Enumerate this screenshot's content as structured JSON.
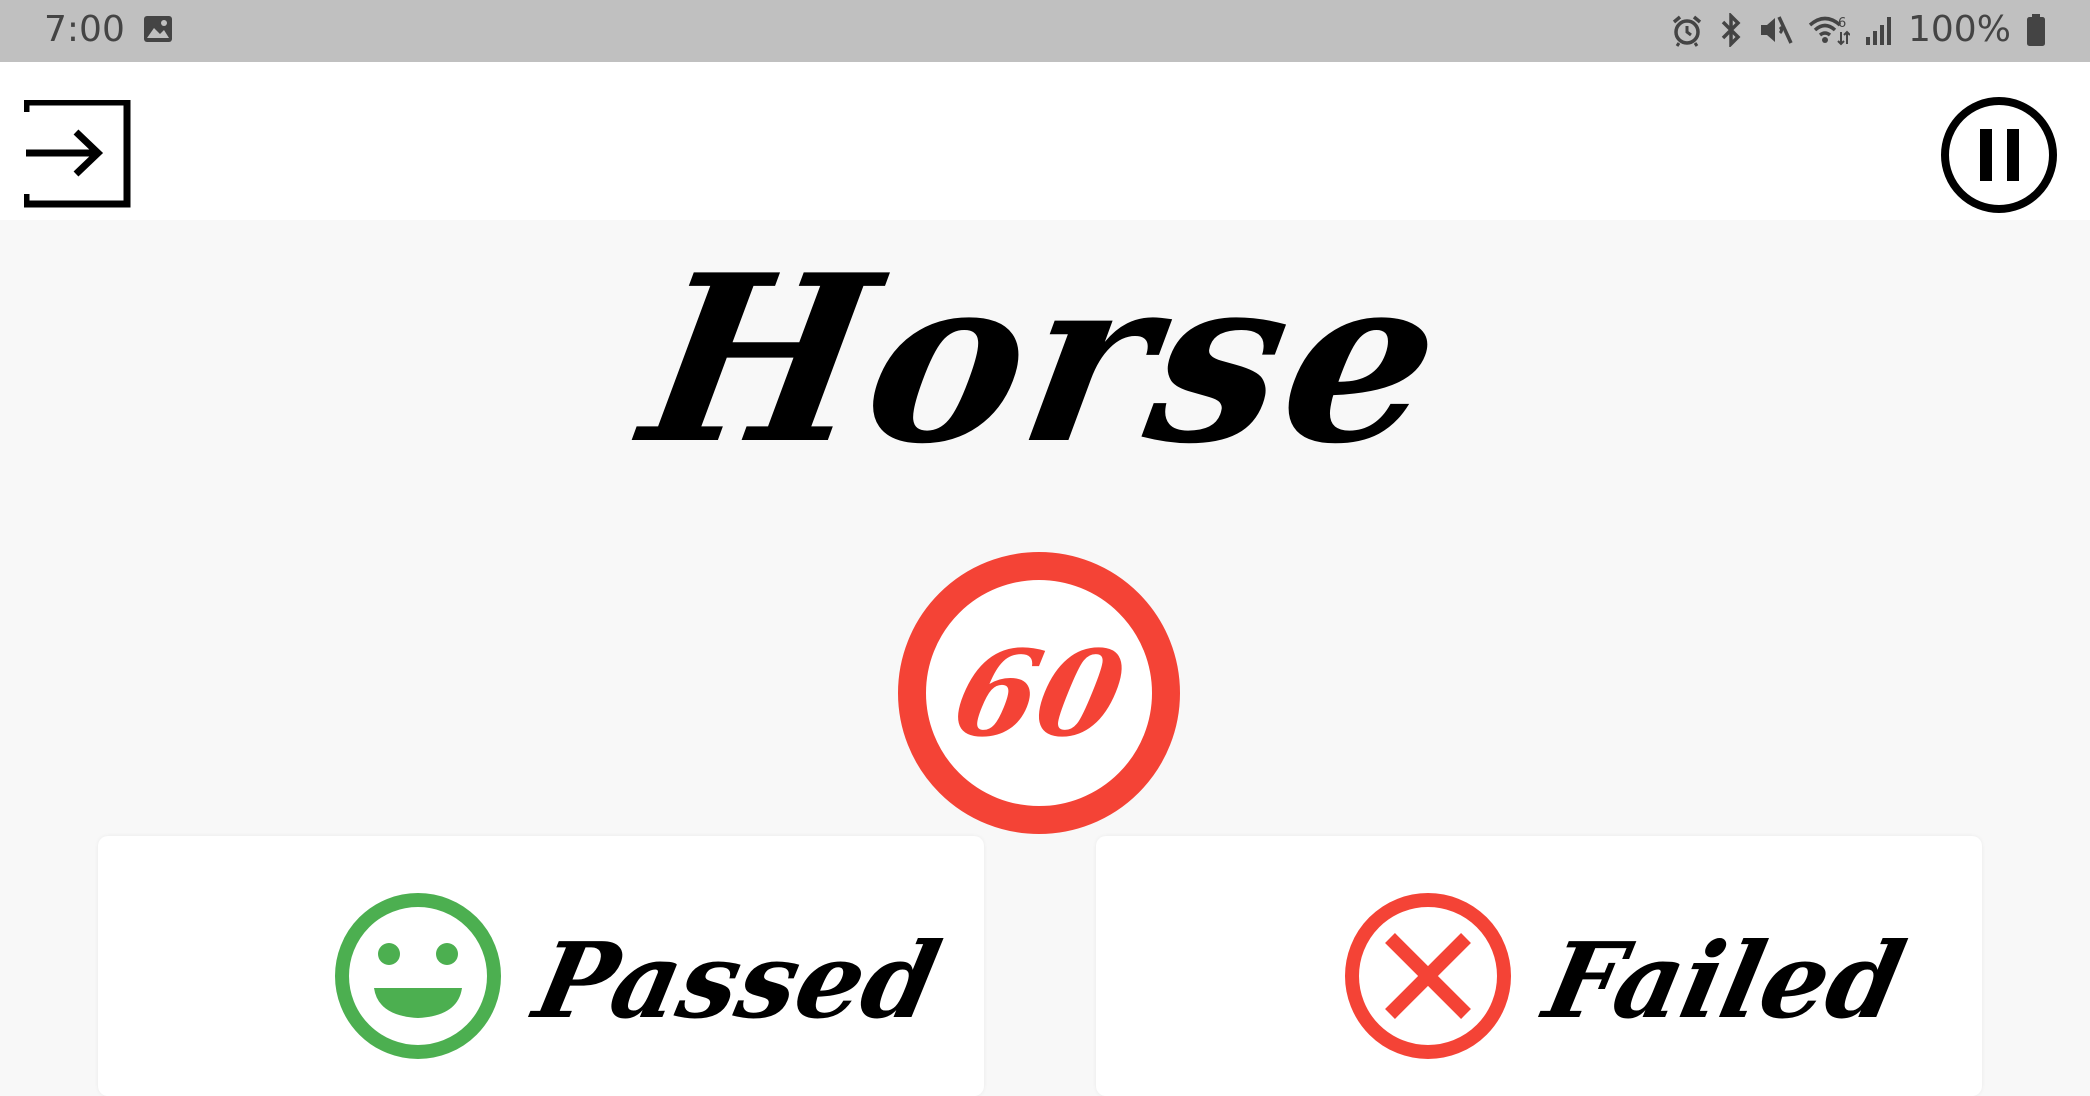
{
  "status_bar": {
    "time": "7:00",
    "battery": "100%",
    "icons": [
      "image-icon",
      "alarm-icon",
      "bluetooth-icon",
      "mute-icon",
      "wifi-icon",
      "signal-icon",
      "battery-icon"
    ]
  },
  "toolbar": {
    "exit_icon": "exit-icon",
    "pause_icon": "pause-icon"
  },
  "game": {
    "word": "Horse",
    "timer": "60",
    "timer_color": "#f44336"
  },
  "actions": {
    "passed": {
      "label": "Passed",
      "icon": "smiley-icon",
      "color": "#4caf50"
    },
    "failed": {
      "label": "Failed",
      "icon": "x-circle-icon",
      "color": "#f44336"
    }
  }
}
